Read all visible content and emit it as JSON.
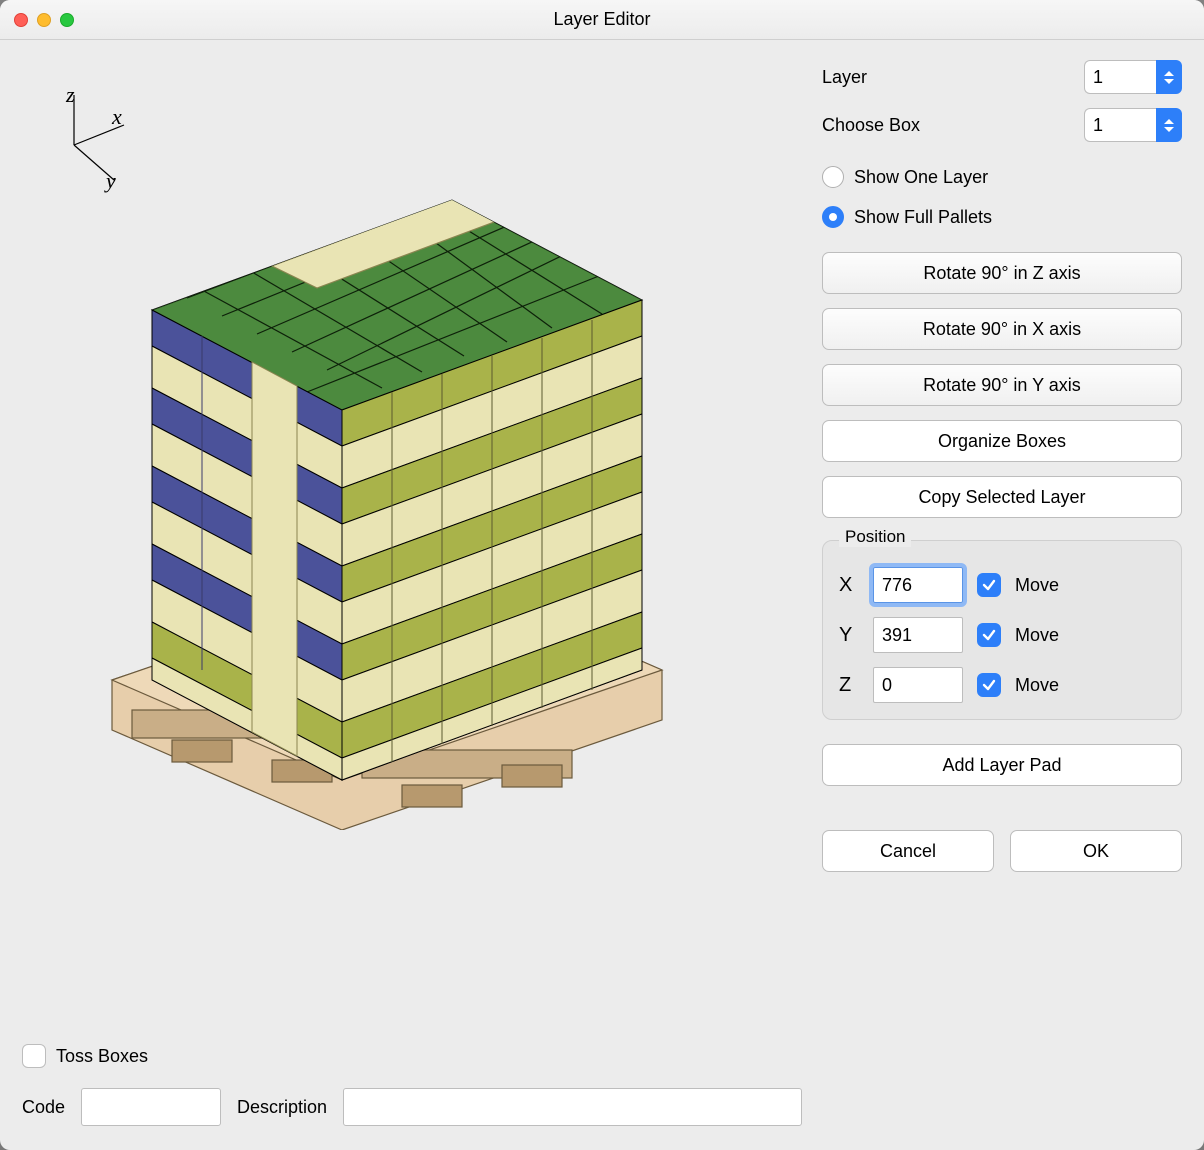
{
  "window": {
    "title": "Layer Editor"
  },
  "viewport": {
    "axis_labels": {
      "x": "x",
      "y": "y",
      "z": "z"
    }
  },
  "controls": {
    "layer_label": "Layer",
    "layer_value": "1",
    "choose_box_label": "Choose Box",
    "choose_box_value": "1",
    "show_one_layer_label": "Show One Layer",
    "show_full_pallets_label": "Show Full Pallets",
    "show_mode": "full",
    "rotate_z_label": "Rotate 90° in Z axis",
    "rotate_x_label": "Rotate 90° in X axis",
    "rotate_y_label": "Rotate 90° in Y axis",
    "organize_label": "Organize Boxes",
    "copy_layer_label": "Copy Selected Layer",
    "add_layer_pad_label": "Add Layer Pad",
    "cancel_label": "Cancel",
    "ok_label": "OK"
  },
  "position": {
    "legend": "Position",
    "x_label": "X",
    "x_value": "776",
    "x_move": true,
    "y_label": "Y",
    "y_value": "391",
    "y_move": true,
    "z_label": "Z",
    "z_value": "0",
    "z_move": true,
    "move_label": "Move"
  },
  "footer": {
    "toss_boxes_label": "Toss Boxes",
    "toss_boxes_checked": false,
    "code_label": "Code",
    "code_value": "",
    "description_label": "Description",
    "description_value": ""
  },
  "pallet": {
    "colors": {
      "top_dark_green": "#4c8a3e",
      "top_mid_green": "#6ea556",
      "olive": "#a9b34a",
      "cream": "#e9e4b4",
      "blue": "#4b529a",
      "wood_light": "#e7ceab",
      "wood_dark": "#c9ae87",
      "outline": "#000000"
    }
  }
}
